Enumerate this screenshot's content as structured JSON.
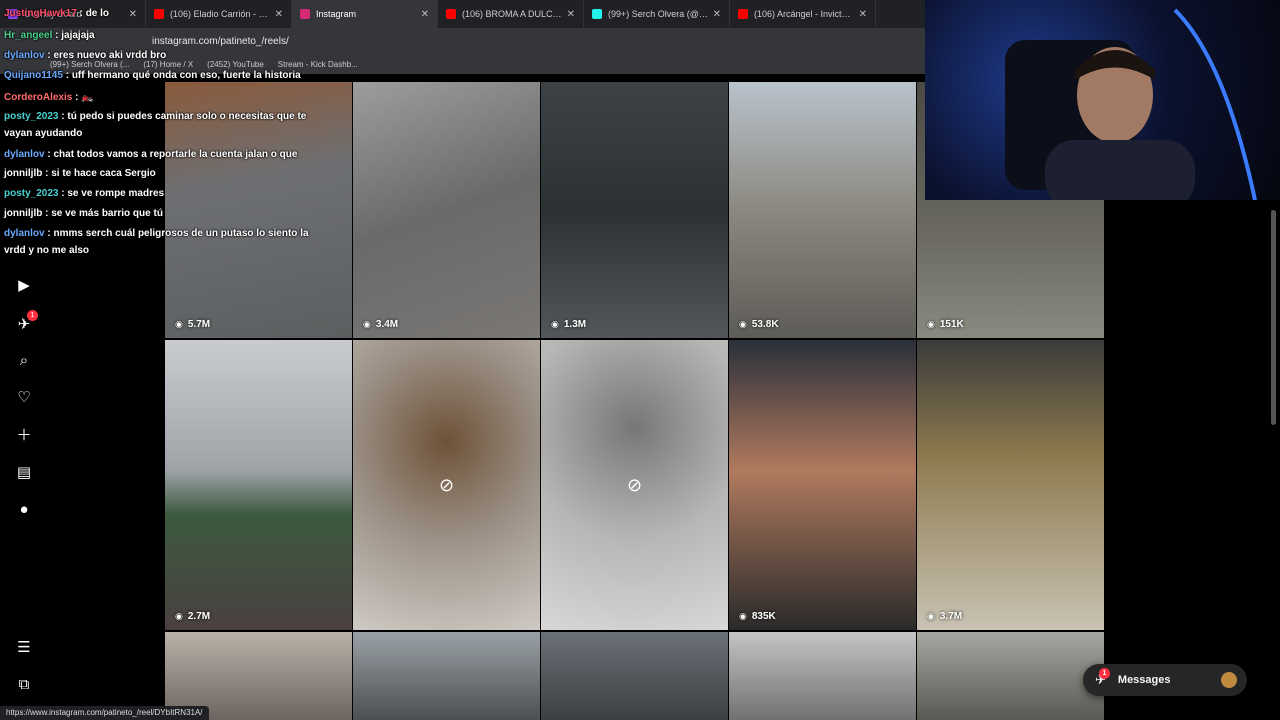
{
  "browser": {
    "tabs": [
      {
        "title": "Overlay Board",
        "color": "#9146ff",
        "active": false
      },
      {
        "title": "(106) Eladio Carrión - La Vi",
        "color": "#ff0000",
        "active": false
      },
      {
        "title": "Instagram",
        "color": "#d62976",
        "active": true
      },
      {
        "title": "(106) BROMA A DULCEROS",
        "color": "#ff0000",
        "active": false
      },
      {
        "title": "(99+) Serch Olvera (@serch",
        "color": "#25f4ee",
        "active": false
      },
      {
        "title": "(106) Arcángel - Invicto (Vi",
        "color": "#ff0000",
        "active": false
      }
    ],
    "address": "instagram.com/patineto_/reels/",
    "bookmarks": [
      "(99+) Serch Olvera (...",
      "(17) Home / X",
      "(2452) YouTube",
      "Stream - Kick Dashb..."
    ],
    "status_url": "https://www.instagram.com/patineto_/reel/DYbItRN31A/"
  },
  "sidebar": {
    "icons": [
      "reels-icon",
      "messages-icon",
      "search-icon",
      "heart-icon",
      "create-icon",
      "insights-icon",
      "profile-icon"
    ],
    "message_badge": "1",
    "bottom_icons": [
      "menu-icon",
      "more-icon"
    ]
  },
  "reels": [
    {
      "views": "5.7M",
      "hidden": false,
      "bg": "linear-gradient(170deg,#8a5a3c 0%,#6d6f73 40%,#5c5f60 100%)"
    },
    {
      "views": "3.4M",
      "hidden": false,
      "bg": "linear-gradient(160deg,#9d9d9d 0%,#6a6a6a 50%,#7a7774 100%)"
    },
    {
      "views": "1.3M",
      "hidden": false,
      "bg": "linear-gradient(180deg,#3c4246 0%,#2c3134 50%,#51575a 100%)"
    },
    {
      "views": "53.8K",
      "hidden": false,
      "bg": "linear-gradient(180deg,#b9c3cc 0%,#8b8880 50%,#5e5c57 100%)"
    },
    {
      "views": "151K",
      "hidden": false,
      "bg": "linear-gradient(180deg,#4a4a44 0%,#6b6a60 60%,#8a8a80 100%)"
    },
    {
      "views": "2.7M",
      "hidden": false,
      "bg": "linear-gradient(180deg,#c9cbcf 0%,#9fa3a8 45%,#3c5a3e 60%,#4a4040 100%)"
    },
    {
      "views": "",
      "hidden": true,
      "bg": "radial-gradient(circle at 50% 35%,#6e5238 0%,#9a8f84 45%,#cfcac4 100%)"
    },
    {
      "views": "",
      "hidden": true,
      "bg": "radial-gradient(circle at 50% 30%,#777 0%,#b6b6b4 50%,#d8d8d6 100%)"
    },
    {
      "views": "835K",
      "hidden": false,
      "bg": "linear-gradient(180deg,#2a2f3a 0%,#b07a5e 45%,#2a2a2a 100%)"
    },
    {
      "views": "3.7M",
      "hidden": false,
      "bg": "linear-gradient(180deg,#3b3b3b 0%,#8d7a4e 40%,#c9c3b4 100%)"
    },
    {
      "views": "",
      "hidden": false,
      "bg": "linear-gradient(180deg,#b9b2a8 0%,#6c6460 100%)"
    },
    {
      "views": "",
      "hidden": false,
      "bg": "linear-gradient(180deg,#9aa1a6 0%,#4c4f52 100%)"
    },
    {
      "views": "",
      "hidden": false,
      "bg": "linear-gradient(180deg,#6b7178 0%,#3d3f42 100%)"
    },
    {
      "views": "",
      "hidden": false,
      "bg": "linear-gradient(180deg,#c4c4c4 0%,#717171 100%)"
    },
    {
      "views": "",
      "hidden": false,
      "bg": "linear-gradient(180deg,#a7a7a2 0%,#595953 100%)"
    }
  ],
  "chat": [
    {
      "user": "JustingHawk17",
      "msg": "de lo",
      "color": "#ff4d6d"
    },
    {
      "user": "Hr_angeel",
      "msg": "jajajaja",
      "color": "#49d18a"
    },
    {
      "user": "dylanlov",
      "msg": "eres nuevo aki vrdd bro",
      "color": "#6aa9ff"
    },
    {
      "user": "Quijano1145",
      "msg": "uff hermano qué onda con eso, fuerte la historia",
      "color": "#6aa9ff"
    },
    {
      "user": "CorderoAlexis",
      "msg": "🏍️",
      "color": "#ff6b6b"
    },
    {
      "user": "posty_2023",
      "msg": "tú pedo si puedes caminar solo o necesitas que te",
      "color": "#49d1d1"
    },
    {
      "user": "",
      "msg": "vayan ayudando",
      "color": "#ffffff"
    },
    {
      "user": "dylanlov",
      "msg": "chat todos vamos a reportarle la cuenta jalan o que",
      "color": "#6aa9ff"
    },
    {
      "user": "jonniljlb",
      "msg": "si te hace caca Sergio",
      "color": "#ffffff"
    },
    {
      "user": "posty_2023",
      "msg": "se ve rompe madres",
      "color": "#49d1d1"
    },
    {
      "user": "jonniljlb",
      "msg": "se ve más barrio que tú",
      "color": "#ffffff"
    },
    {
      "user": "dylanlov",
      "msg": "nmms serch cuál peligrosos de un putaso lo siento la",
      "color": "#6aa9ff"
    },
    {
      "user": "",
      "msg": "vrdd y no me also",
      "color": "#ffffff"
    }
  ],
  "messages_pill": {
    "label": "Messages",
    "badge": "1"
  }
}
